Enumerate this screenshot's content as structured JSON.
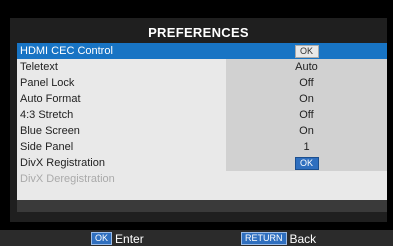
{
  "title": "PREFERENCES",
  "menu": {
    "items": [
      {
        "label": "HDMI CEC Control",
        "value": "OK",
        "kind": "badge",
        "state": "selected"
      },
      {
        "label": "Teletext",
        "value": "Auto",
        "kind": "text",
        "state": "normal"
      },
      {
        "label": "Panel Lock",
        "value": "Off",
        "kind": "text",
        "state": "normal"
      },
      {
        "label": "Auto Format",
        "value": "On",
        "kind": "text",
        "state": "normal"
      },
      {
        "label": "4:3 Stretch",
        "value": "Off",
        "kind": "text",
        "state": "normal"
      },
      {
        "label": "Blue Screen",
        "value": "On",
        "kind": "text",
        "state": "normal"
      },
      {
        "label": "Side Panel",
        "value": "1",
        "kind": "text",
        "state": "normal"
      },
      {
        "label": "DivX Registration",
        "value": "OK",
        "kind": "badge",
        "state": "normal"
      },
      {
        "label": "DivX Deregistration",
        "value": "",
        "kind": "text",
        "state": "disabled"
      }
    ]
  },
  "footer": {
    "enter_key": "OK",
    "enter_label": "Enter",
    "back_key": "RETURN",
    "back_label": "Back"
  },
  "colors": {
    "selection": "#1874c4",
    "key_badge": "#2f6fbf"
  }
}
